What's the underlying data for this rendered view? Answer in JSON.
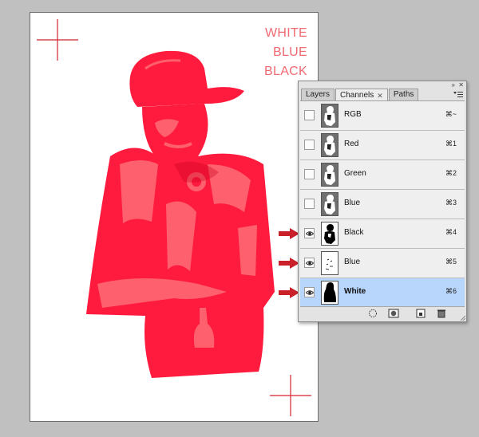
{
  "document": {
    "plates": [
      "WHITE",
      "BLUE",
      "BLACK"
    ],
    "colors": {
      "ink_primary": "#ff1b3e",
      "ink_light": "#ff606e",
      "ink_dark": "#c9001f",
      "register": "#d42030",
      "label": "#f06a72"
    }
  },
  "panel": {
    "tabs": [
      {
        "label": "Layers",
        "active": false
      },
      {
        "label": "Channels",
        "active": true
      },
      {
        "label": "Paths",
        "active": false
      }
    ],
    "close_glyph": "✕",
    "panel_close_glyph": "✕",
    "collapse_glyph": "»",
    "channels": [
      {
        "name": "RGB",
        "shortcut": "⌘~",
        "visible": false,
        "selected": false,
        "thumb": "gray"
      },
      {
        "name": "Red",
        "shortcut": "⌘1",
        "visible": false,
        "selected": false,
        "thumb": "gray"
      },
      {
        "name": "Green",
        "shortcut": "⌘2",
        "visible": false,
        "selected": false,
        "thumb": "gray"
      },
      {
        "name": "Blue",
        "shortcut": "⌘3",
        "visible": false,
        "selected": false,
        "thumb": "gray"
      },
      {
        "name": "Black",
        "shortcut": "⌘4",
        "visible": true,
        "selected": false,
        "thumb": "black"
      },
      {
        "name": "Blue",
        "shortcut": "⌘5",
        "visible": true,
        "selected": false,
        "thumb": "blue"
      },
      {
        "name": "White",
        "shortcut": "⌘6",
        "visible": true,
        "selected": true,
        "thumb": "white"
      }
    ],
    "bottom_buttons": [
      "load-selection-icon",
      "save-selection-icon",
      "new-channel-icon",
      "trash-icon"
    ],
    "arrow_color": "#c9202a"
  }
}
